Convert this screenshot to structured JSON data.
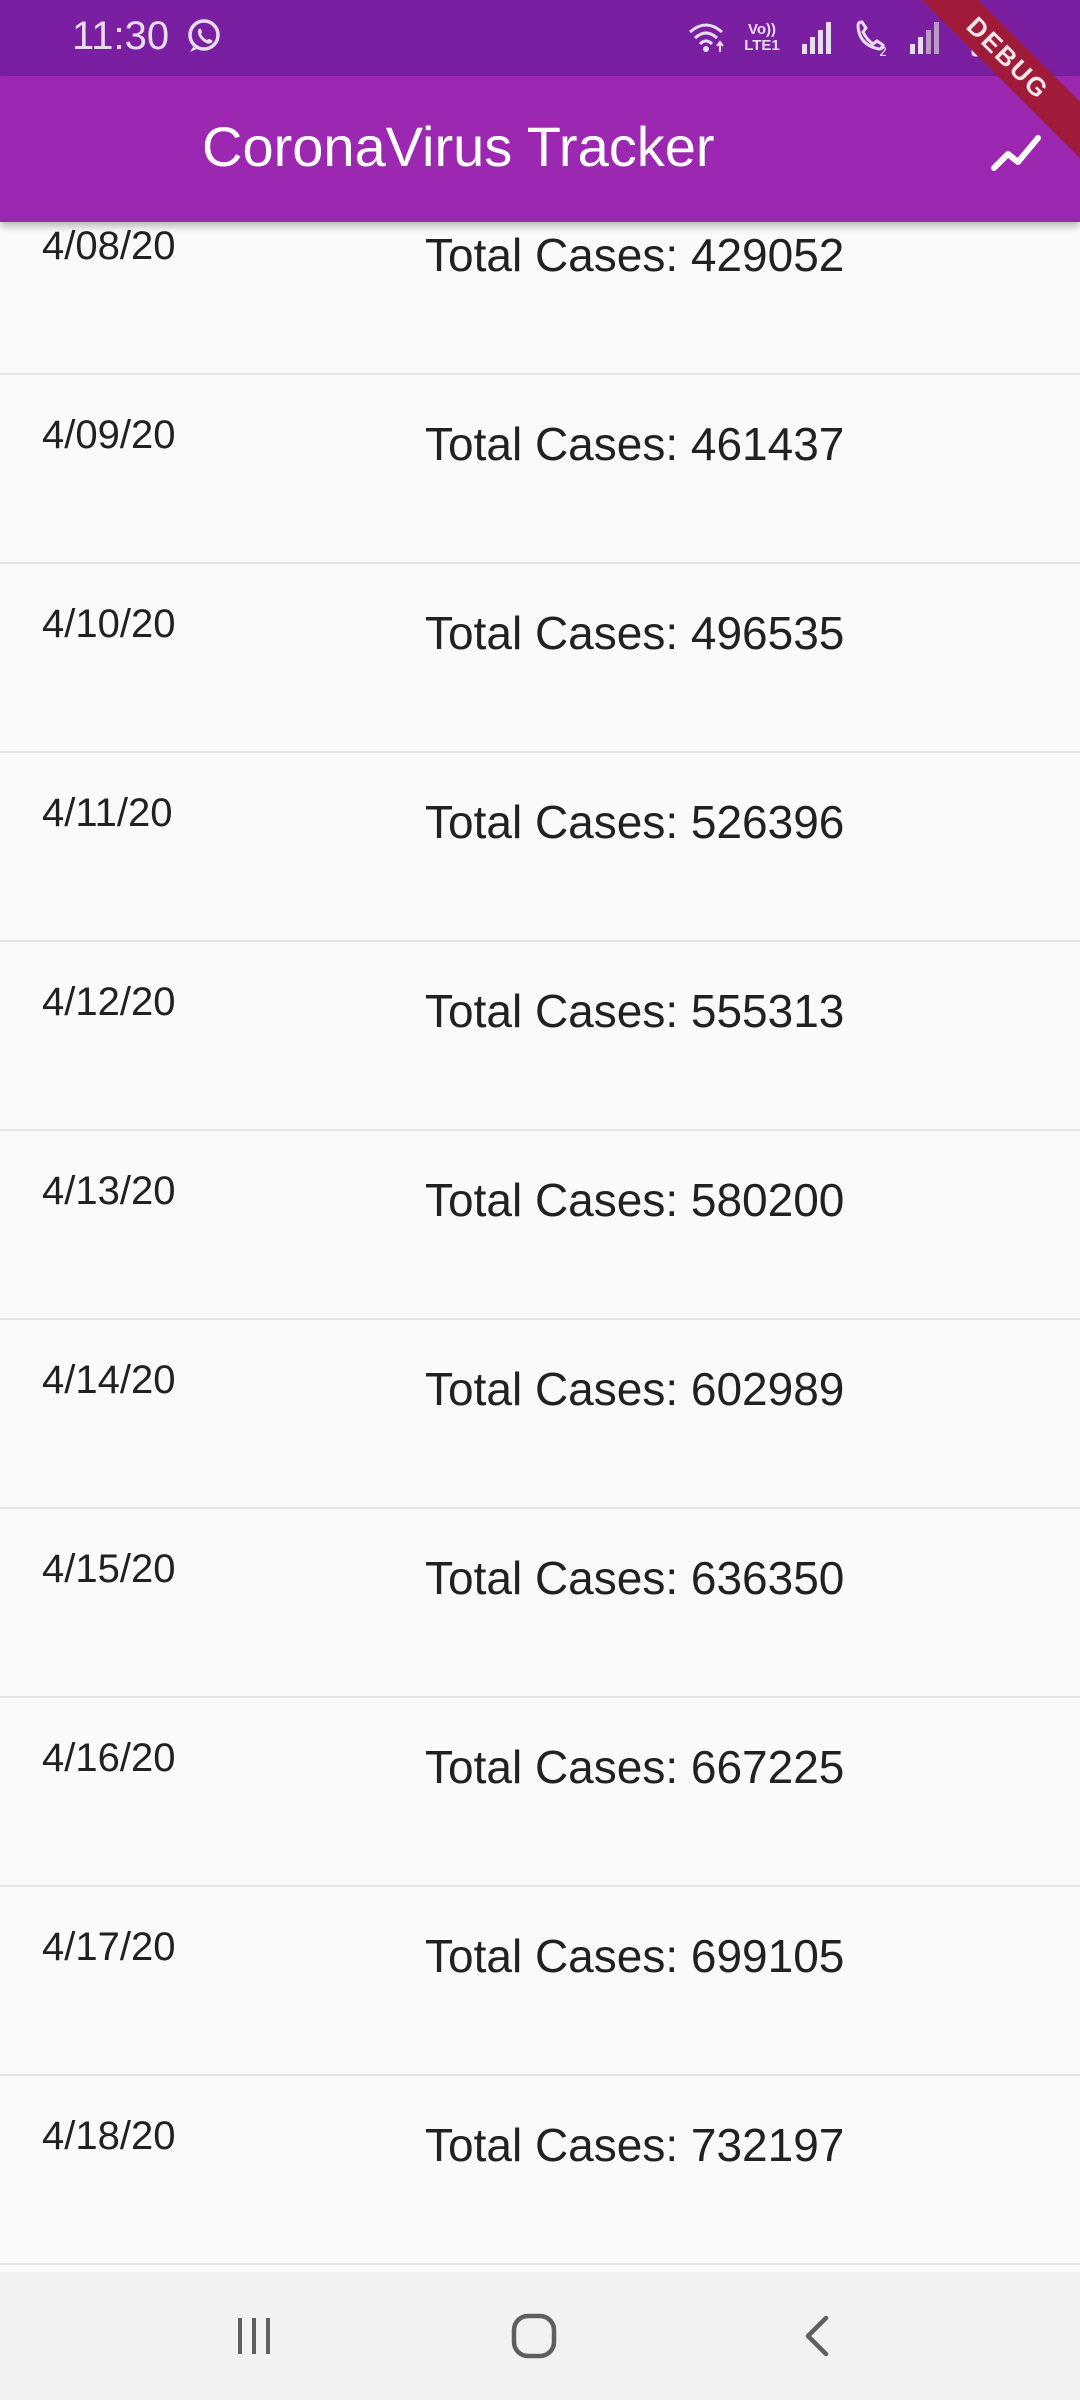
{
  "status_bar": {
    "time": "11:30",
    "icons": [
      "whatsapp-icon",
      "wifi-icon",
      "volte-lte-icon",
      "signal-icon",
      "wifi-calling-icon",
      "signal-2-icon",
      "battery-icon"
    ],
    "lte_top": "Vo))",
    "lte_bottom": "LTE1"
  },
  "debug_banner": "DEBUG",
  "app_bar": {
    "title": "CoronaVirus Tracker",
    "action_icon": "trending-up-icon",
    "background": "#9c27b0",
    "status_color": "#7b1fa2"
  },
  "rows": [
    {
      "date": "4/08/20",
      "total": "Total Cases: 429052"
    },
    {
      "date": "4/09/20",
      "total": "Total Cases: 461437"
    },
    {
      "date": "4/10/20",
      "total": "Total Cases: 496535"
    },
    {
      "date": "4/11/20",
      "total": "Total Cases: 526396"
    },
    {
      "date": "4/12/20",
      "total": "Total Cases: 555313"
    },
    {
      "date": "4/13/20",
      "total": "Total Cases: 580200"
    },
    {
      "date": "4/14/20",
      "total": "Total Cases: 602989"
    },
    {
      "date": "4/15/20",
      "total": "Total Cases: 636350"
    },
    {
      "date": "4/16/20",
      "total": "Total Cases: 667225"
    },
    {
      "date": "4/17/20",
      "total": "Total Cases: 699105"
    },
    {
      "date": "4/18/20",
      "total": "Total Cases: 732197"
    }
  ],
  "nav_bar": {
    "buttons": [
      "recent-apps-icon",
      "home-icon",
      "back-icon"
    ]
  }
}
